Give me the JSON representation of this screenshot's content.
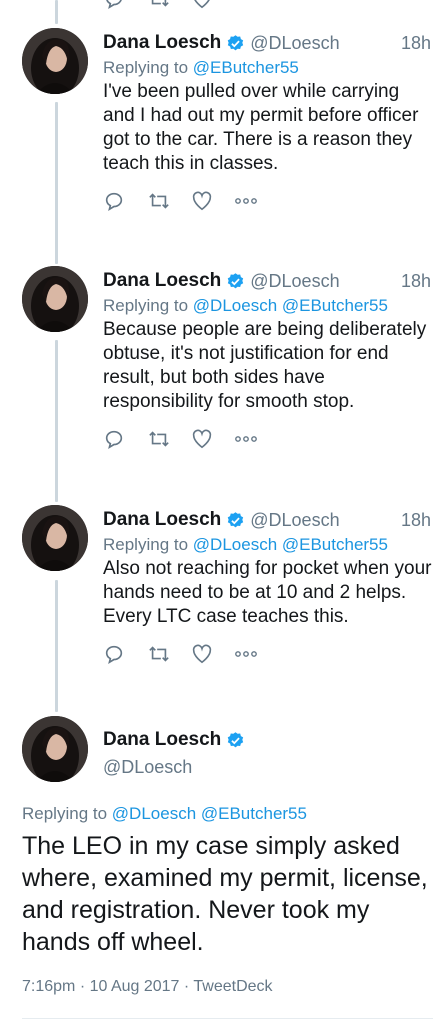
{
  "author": {
    "name": "Dana Loesch",
    "handle": "@DLoesch"
  },
  "colors": {
    "link": "#1b95e0",
    "muted": "#657786",
    "text": "#14171a",
    "thread_line": "#ccd6dd"
  },
  "tweets": [
    {
      "time": "18h",
      "replying_label": "Replying to",
      "mentions": "@EButcher55",
      "text": "I've been pulled over while carrying and I had out my permit before officer got to the car. There is a reason they teach this in classes."
    },
    {
      "time": "18h",
      "replying_label": "Replying to",
      "mentions": "@DLoesch @EButcher55",
      "text": "Because people are being deliberately obtuse, it's not justification for end result, but both sides have responsibility for smooth stop."
    },
    {
      "time": "18h",
      "replying_label": "Replying to",
      "mentions": "@DLoesch @EButcher55",
      "text": "Also not reaching for pocket when your hands need to be at 10 and 2 helps. Every LTC case teaches this."
    }
  ],
  "focus_tweet": {
    "replying_label": "Replying to",
    "mentions": "@DLoesch @EButcher55",
    "text": "The LEO in my case simply asked where, examined my permit, license, and registration. Never took my hands off wheel.",
    "meta": "7:16pm · 10 Aug 2017 · TweetDeck"
  },
  "icons": {
    "reply": "reply-icon",
    "retweet": "retweet-icon",
    "like": "heart-icon",
    "more": "more-icon",
    "verified": "verified-badge-icon"
  }
}
